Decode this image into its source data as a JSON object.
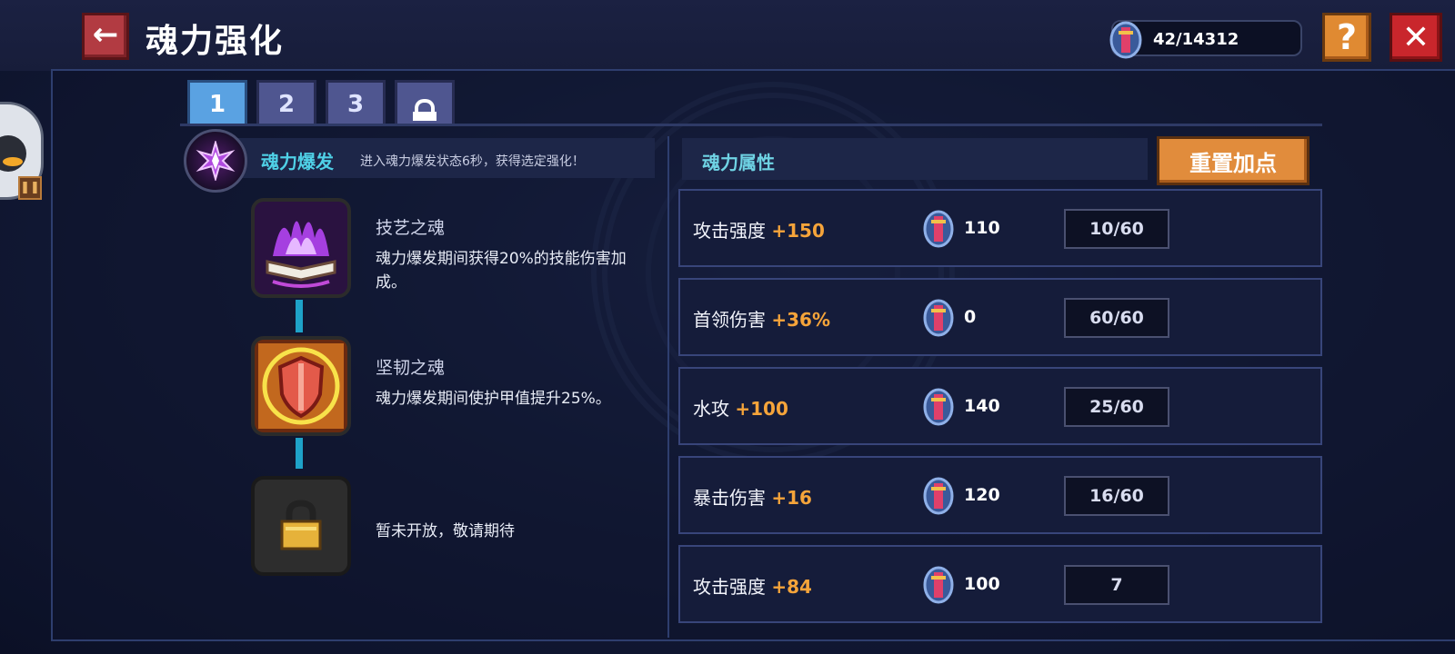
{
  "header": {
    "title": "魂力强化",
    "currency": "42/14312"
  },
  "tabs": [
    {
      "label": "1",
      "active": true
    },
    {
      "label": "2",
      "active": false
    },
    {
      "label": "3",
      "active": false
    },
    {
      "label": "",
      "icon": "lock-icon",
      "active": false
    }
  ],
  "burst": {
    "title": "魂力爆发",
    "description": "进入魂力爆发状态6秒，获得选定强化！"
  },
  "skills": [
    {
      "name": "技艺之魂",
      "description": "魂力爆发期间获得20%的技能伤害加成。",
      "icon": "soul-book-icon"
    },
    {
      "name": "坚韧之魂",
      "description": "魂力爆发期间使护甲值提升25%。",
      "icon": "soul-shield-icon"
    },
    {
      "name": "",
      "description": "暂未开放，敬请期待",
      "icon": "padlock-icon"
    }
  ],
  "attributes": {
    "header": "魂力属性",
    "reset_label": "重置加点",
    "rows": [
      {
        "name": "攻击强度",
        "bonus": "+150",
        "cost": "110",
        "level": "10/60"
      },
      {
        "name": "首领伤害",
        "bonus": "+36%",
        "cost": "0",
        "level": "60/60"
      },
      {
        "name": "水攻",
        "bonus": "+100",
        "cost": "140",
        "level": "25/60"
      },
      {
        "name": "暴击伤害",
        "bonus": "+16",
        "cost": "120",
        "level": "16/60"
      },
      {
        "name": "攻击强度",
        "bonus": "+84",
        "cost": "100",
        "level": "7"
      }
    ]
  },
  "colors": {
    "accent_cyan": "#4fd0e6",
    "bonus_orange": "#f5a43a",
    "tab_active": "#5aa2e2",
    "reset_button": "#e18c3c",
    "close_button": "#c9262c"
  }
}
